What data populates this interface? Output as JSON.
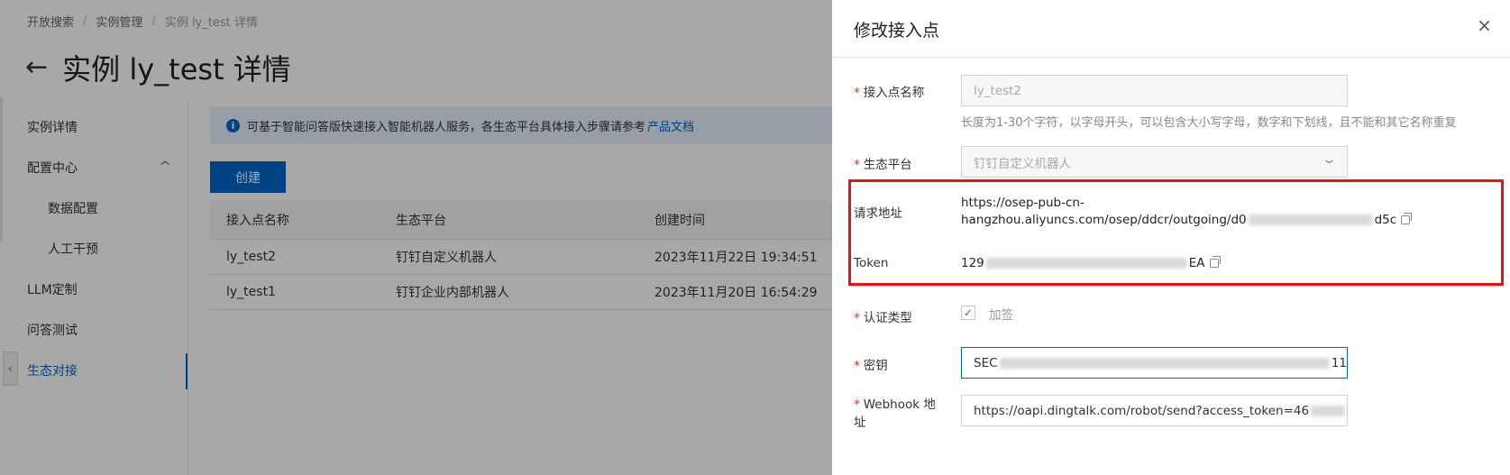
{
  "breadcrumb": [
    "开放搜索",
    "实例管理",
    "实例 ly_test 详情"
  ],
  "page_title": "实例 ly_test 详情",
  "sidebar": {
    "items": [
      {
        "label": "实例详情"
      },
      {
        "label": "配置中心"
      },
      {
        "label": "数据配置"
      },
      {
        "label": "人工干预"
      },
      {
        "label": "LLM定制"
      },
      {
        "label": "问答测试"
      },
      {
        "label": "生态对接"
      }
    ]
  },
  "info": {
    "text": "可基于智能问答版快速接入智能机器人服务，各生态平台具体接入步骤请参考",
    "link": "产品文档"
  },
  "create_button": "创建",
  "table": {
    "headers": [
      "接入点名称",
      "生态平台",
      "创建时间"
    ],
    "rows": [
      [
        "ly_test2",
        "钉钉自定义机器人",
        "2023年11月22日 19:34:51"
      ],
      [
        "ly_test1",
        "钉钉企业内部机器人",
        "2023年11月20日 16:54:29"
      ]
    ]
  },
  "drawer": {
    "title": "修改接入点",
    "close": "×",
    "name_label": "接入点名称",
    "name_value": "ly_test2",
    "name_hint": "长度为1-30个字符，以字母开头，可以包含大小写字母，数字和下划线，且不能和其它名称重复",
    "platform_label": "生态平台",
    "platform_value": "钉钉自定义机器人",
    "request_url_label": "请求地址",
    "request_url_line1": "https://osep-pub-cn-",
    "request_url_line2_prefix": "hangzhou.aliyuncs.com/osep/ddcr/outgoing/d0",
    "request_url_line2_suffix": "d5c",
    "token_label": "Token",
    "token_prefix": "129",
    "token_suffix": "EA",
    "auth_label": "认证类型",
    "auth_option": "加签",
    "secret_label": "密钥",
    "secret_prefix": "SEC",
    "secret_suffix": "11",
    "webhook_label_line1": "Webhook 地",
    "webhook_label_line2": "址",
    "webhook_value": "https://oapi.dingtalk.com/robot/send?access_token=46"
  }
}
